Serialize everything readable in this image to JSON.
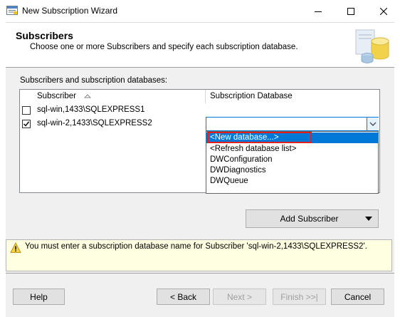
{
  "window": {
    "title": "New Subscription Wizard"
  },
  "header": {
    "title": "Subscribers",
    "subtitle": "Choose one or more Subscribers and specify each subscription database."
  },
  "main": {
    "list_label": "Subscribers and subscription databases:",
    "columns": [
      "Subscriber",
      "Subscription Database"
    ],
    "rows": [
      {
        "checked": false,
        "subscriber": "sql-win,1433\\SQLEXPRESS1",
        "database": ""
      },
      {
        "checked": true,
        "subscriber": "sql-win-2,1433\\SQLEXPRESS2",
        "database": ""
      }
    ],
    "dropdown_options": [
      "<New database...>",
      "<Refresh database list>",
      "DWConfiguration",
      "DWDiagnostics",
      "DWQueue"
    ],
    "dropdown_selected_index": 0,
    "add_subscriber_label": "Add Subscriber"
  },
  "warning": {
    "text": "You must enter a subscription database name for Subscriber 'sql-win-2,1433\\SQLEXPRESS2'."
  },
  "footer": {
    "help": "Help",
    "back": "< Back",
    "next": "Next >",
    "finish": "Finish >>|",
    "cancel": "Cancel"
  },
  "colors": {
    "selection": "#0078d7",
    "highlight_outline": "#e0201c",
    "warning_bg": "#ffffe1"
  }
}
